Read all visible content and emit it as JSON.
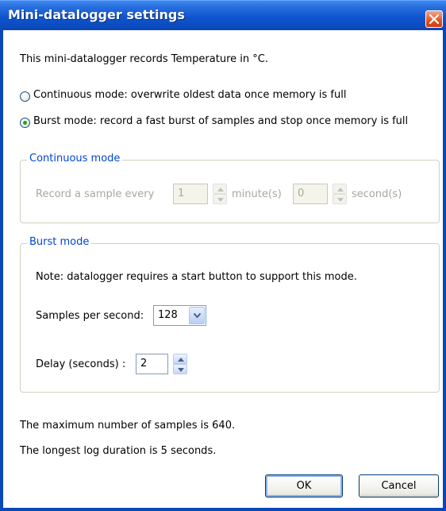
{
  "window": {
    "title": "Mini-datalogger settings"
  },
  "intro": "This mini-datalogger records Temperature in °C.",
  "modes": {
    "continuous_label": "Continuous mode: overwrite oldest data once memory is full",
    "continuous_selected": false,
    "burst_label": "Burst mode: record a fast burst of samples and stop once memory is full",
    "burst_selected": true
  },
  "continuous_group": {
    "title": "Continuous mode",
    "record_label": "Record a sample every",
    "minutes_value": "1",
    "minutes_unit": "minute(s)",
    "seconds_value": "0",
    "seconds_unit": "second(s)"
  },
  "burst_group": {
    "title": "Burst mode",
    "note": "Note: datalogger requires a start button to support this mode.",
    "samples_label": "Samples per second:",
    "samples_value": "128",
    "delay_label": "Delay (seconds) :",
    "delay_value": "2"
  },
  "summary": {
    "max_samples": "The maximum number of samples is 640.",
    "longest_duration": "The longest log duration is 5 seconds."
  },
  "buttons": {
    "ok": "OK",
    "cancel": "Cancel"
  },
  "colors": {
    "titlebar": "#0a47b8",
    "group_label": "#0046d5",
    "radio_selected": "#21a121",
    "close_button": "#e0531f"
  }
}
